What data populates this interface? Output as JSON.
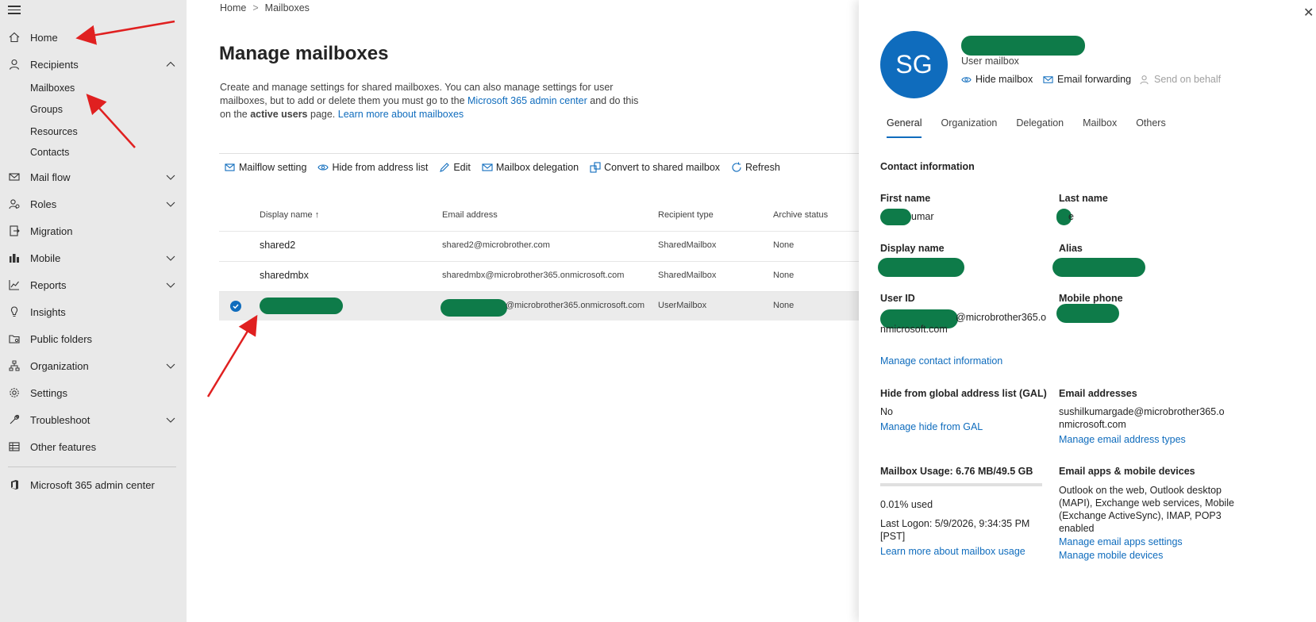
{
  "sidebar": {
    "items": [
      {
        "label": "Home",
        "icon": "home-icon"
      },
      {
        "label": "Recipients",
        "icon": "person-icon"
      },
      {
        "label": "Mail flow",
        "icon": "mail-icon"
      },
      {
        "label": "Roles",
        "icon": "roles-icon"
      },
      {
        "label": "Migration",
        "icon": "migration-icon"
      },
      {
        "label": "Mobile",
        "icon": "mobile-icon"
      },
      {
        "label": "Reports",
        "icon": "chart-icon"
      },
      {
        "label": "Insights",
        "icon": "lightbulb-icon"
      },
      {
        "label": "Public folders",
        "icon": "folder-icon"
      },
      {
        "label": "Organization",
        "icon": "org-icon"
      },
      {
        "label": "Settings",
        "icon": "gear-icon"
      },
      {
        "label": "Troubleshoot",
        "icon": "wrench-icon"
      },
      {
        "label": "Other features",
        "icon": "grid-icon"
      }
    ],
    "recipients_sub": [
      "Mailboxes",
      "Groups",
      "Resources",
      "Contacts"
    ],
    "admin_center": "Microsoft 365 admin center"
  },
  "breadcrumb": {
    "home": "Home",
    "current": "Mailboxes"
  },
  "main": {
    "title": "Manage mailboxes",
    "desc_1": "Create and manage settings for shared mailboxes. You can also manage settings for user mailboxes, but to add or delete them you must go to the ",
    "desc_link1": "Microsoft 365 admin center",
    "desc_2": " and do this on the ",
    "desc_bold": "active users",
    "desc_3": " page. ",
    "desc_link2": "Learn more about mailboxes"
  },
  "toolbar": {
    "mailflow": "Mailflow setting",
    "hide": "Hide from address list",
    "edit": "Edit",
    "delegation": "Mailbox delegation",
    "convert": "Convert to shared mailbox",
    "refresh": "Refresh"
  },
  "table": {
    "columns": [
      "Display name",
      "Email address",
      "Recipient type",
      "Archive status"
    ],
    "sort_arrow": "↑",
    "rows": [
      {
        "name": "shared2",
        "email": "shared2@microbrother.com",
        "type": "SharedMailbox",
        "archive": "None"
      },
      {
        "name": "sharedmbx",
        "email": "sharedmbx@microbrother365.onmicrosoft.com",
        "type": "SharedMailbox",
        "archive": "None"
      },
      {
        "name": "",
        "email": "@microbrother365.onmicrosoft.com",
        "type": "UserMailbox",
        "archive": "None"
      }
    ]
  },
  "panel": {
    "initials": "SG",
    "mailbox_type": "User mailbox",
    "quick": {
      "hide": "Hide mailbox",
      "forwarding": "Email forwarding",
      "send_behalf": "Send on behalf"
    },
    "tabs": [
      "General",
      "Organization",
      "Delegation",
      "Mailbox",
      "Others"
    ],
    "contact_info": "Contact information",
    "first_name_label": "First name",
    "first_name_val": "umar",
    "last_name_label": "Last name",
    "last_name_val": "e",
    "display_name_label": "Display name",
    "alias_label": "Alias",
    "user_id_label": "User ID",
    "user_id_val_1": "@microbrother365.o",
    "user_id_val_2": "nmicrosoft.com",
    "mobile_label": "Mobile phone",
    "manage_contact": "Manage contact information",
    "gal_label": "Hide from global address list (GAL)",
    "gal_val": "No",
    "manage_gal": "Manage hide from GAL",
    "email_addr_label": "Email addresses",
    "email_addr_1": "sushilkumargade@microbrother365.o",
    "email_addr_2": "nmicrosoft.com",
    "manage_email_types": "Manage email address types",
    "usage_label": "Mailbox Usage: 6.76 MB/49.5 GB",
    "usage_fraction": 0.0001,
    "usage_pct": "0.01% used",
    "last_logon_1": "Last Logon: 5/9/2026, 9:34:35 PM",
    "last_logon_2": "[PST]",
    "learn_usage": "Learn more about mailbox usage",
    "apps_label": "Email apps & mobile devices",
    "apps_1": "Outlook on the web, Outlook desktop",
    "apps_2": "(MAPI), Exchange web services, Mobile",
    "apps_3": "(Exchange ActiveSync), IMAP, POP3",
    "apps_4": "enabled",
    "manage_apps": "Manage email apps settings",
    "manage_mobile": "Manage mobile devices",
    "close": "✕"
  },
  "colors": {
    "accent": "#0f6cbd",
    "redaction": "#0e7b49",
    "annotation": "#e02020"
  }
}
